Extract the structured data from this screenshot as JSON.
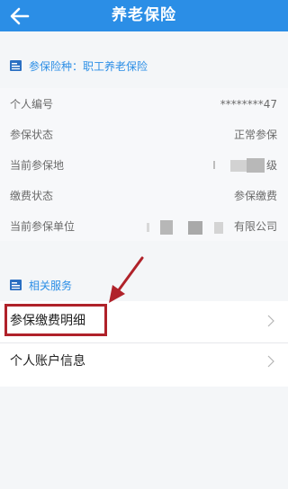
{
  "header": {
    "title": "养老保险",
    "back_icon": "back-arrow-icon"
  },
  "insurance_section": {
    "label": "参保险种：职工养老保险",
    "icon": "card-icon"
  },
  "info_rows": [
    {
      "label": "个人编号",
      "value": "********47"
    },
    {
      "label": "参保状态",
      "value": "正常参保"
    },
    {
      "label": "当前参保地",
      "value": "级"
    },
    {
      "label": "缴费状态",
      "value": "参保缴费"
    },
    {
      "label": "当前参保单位",
      "value": "有限公司"
    }
  ],
  "services_section": {
    "label": "相关服务",
    "icon": "card-icon"
  },
  "services": [
    {
      "label": "参保缴费明细"
    },
    {
      "label": "个人账户信息"
    }
  ],
  "colors": {
    "accent": "#2b8ee6",
    "highlight": "#b0222a"
  }
}
